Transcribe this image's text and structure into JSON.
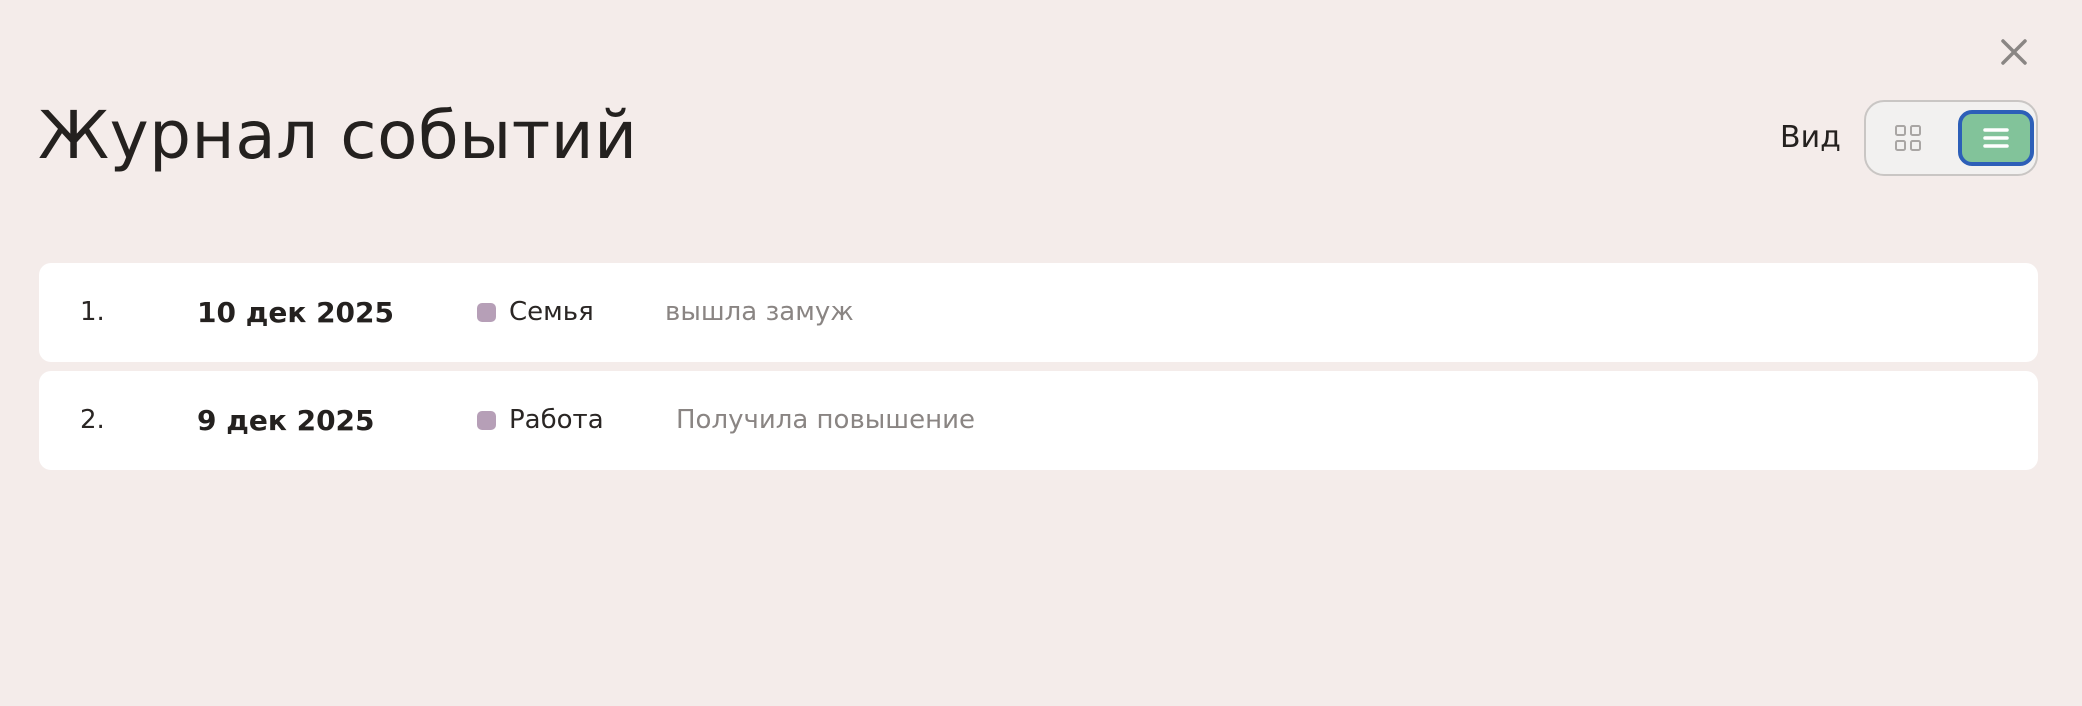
{
  "header": {
    "title": "Журнал событий",
    "view_label": "Вид",
    "close_icon": "close-icon",
    "view_options": [
      {
        "name": "grid",
        "icon": "grid-icon",
        "active": false
      },
      {
        "name": "list",
        "icon": "list-icon",
        "active": true
      }
    ]
  },
  "events": [
    {
      "number": "1.",
      "date": "10 дек 2025",
      "category": "Семья",
      "description": "вышла замуж"
    },
    {
      "number": "2.",
      "date": "9 дек 2025",
      "category": "Работа",
      "description": "Получила повышение"
    }
  ],
  "colors": {
    "background": "#f4ecea",
    "card": "#ffffff",
    "accent_active": "#82c39a",
    "focus_ring": "#2d5fb8",
    "category_dot": "#b69fb7",
    "muted_text": "#8a8583"
  }
}
